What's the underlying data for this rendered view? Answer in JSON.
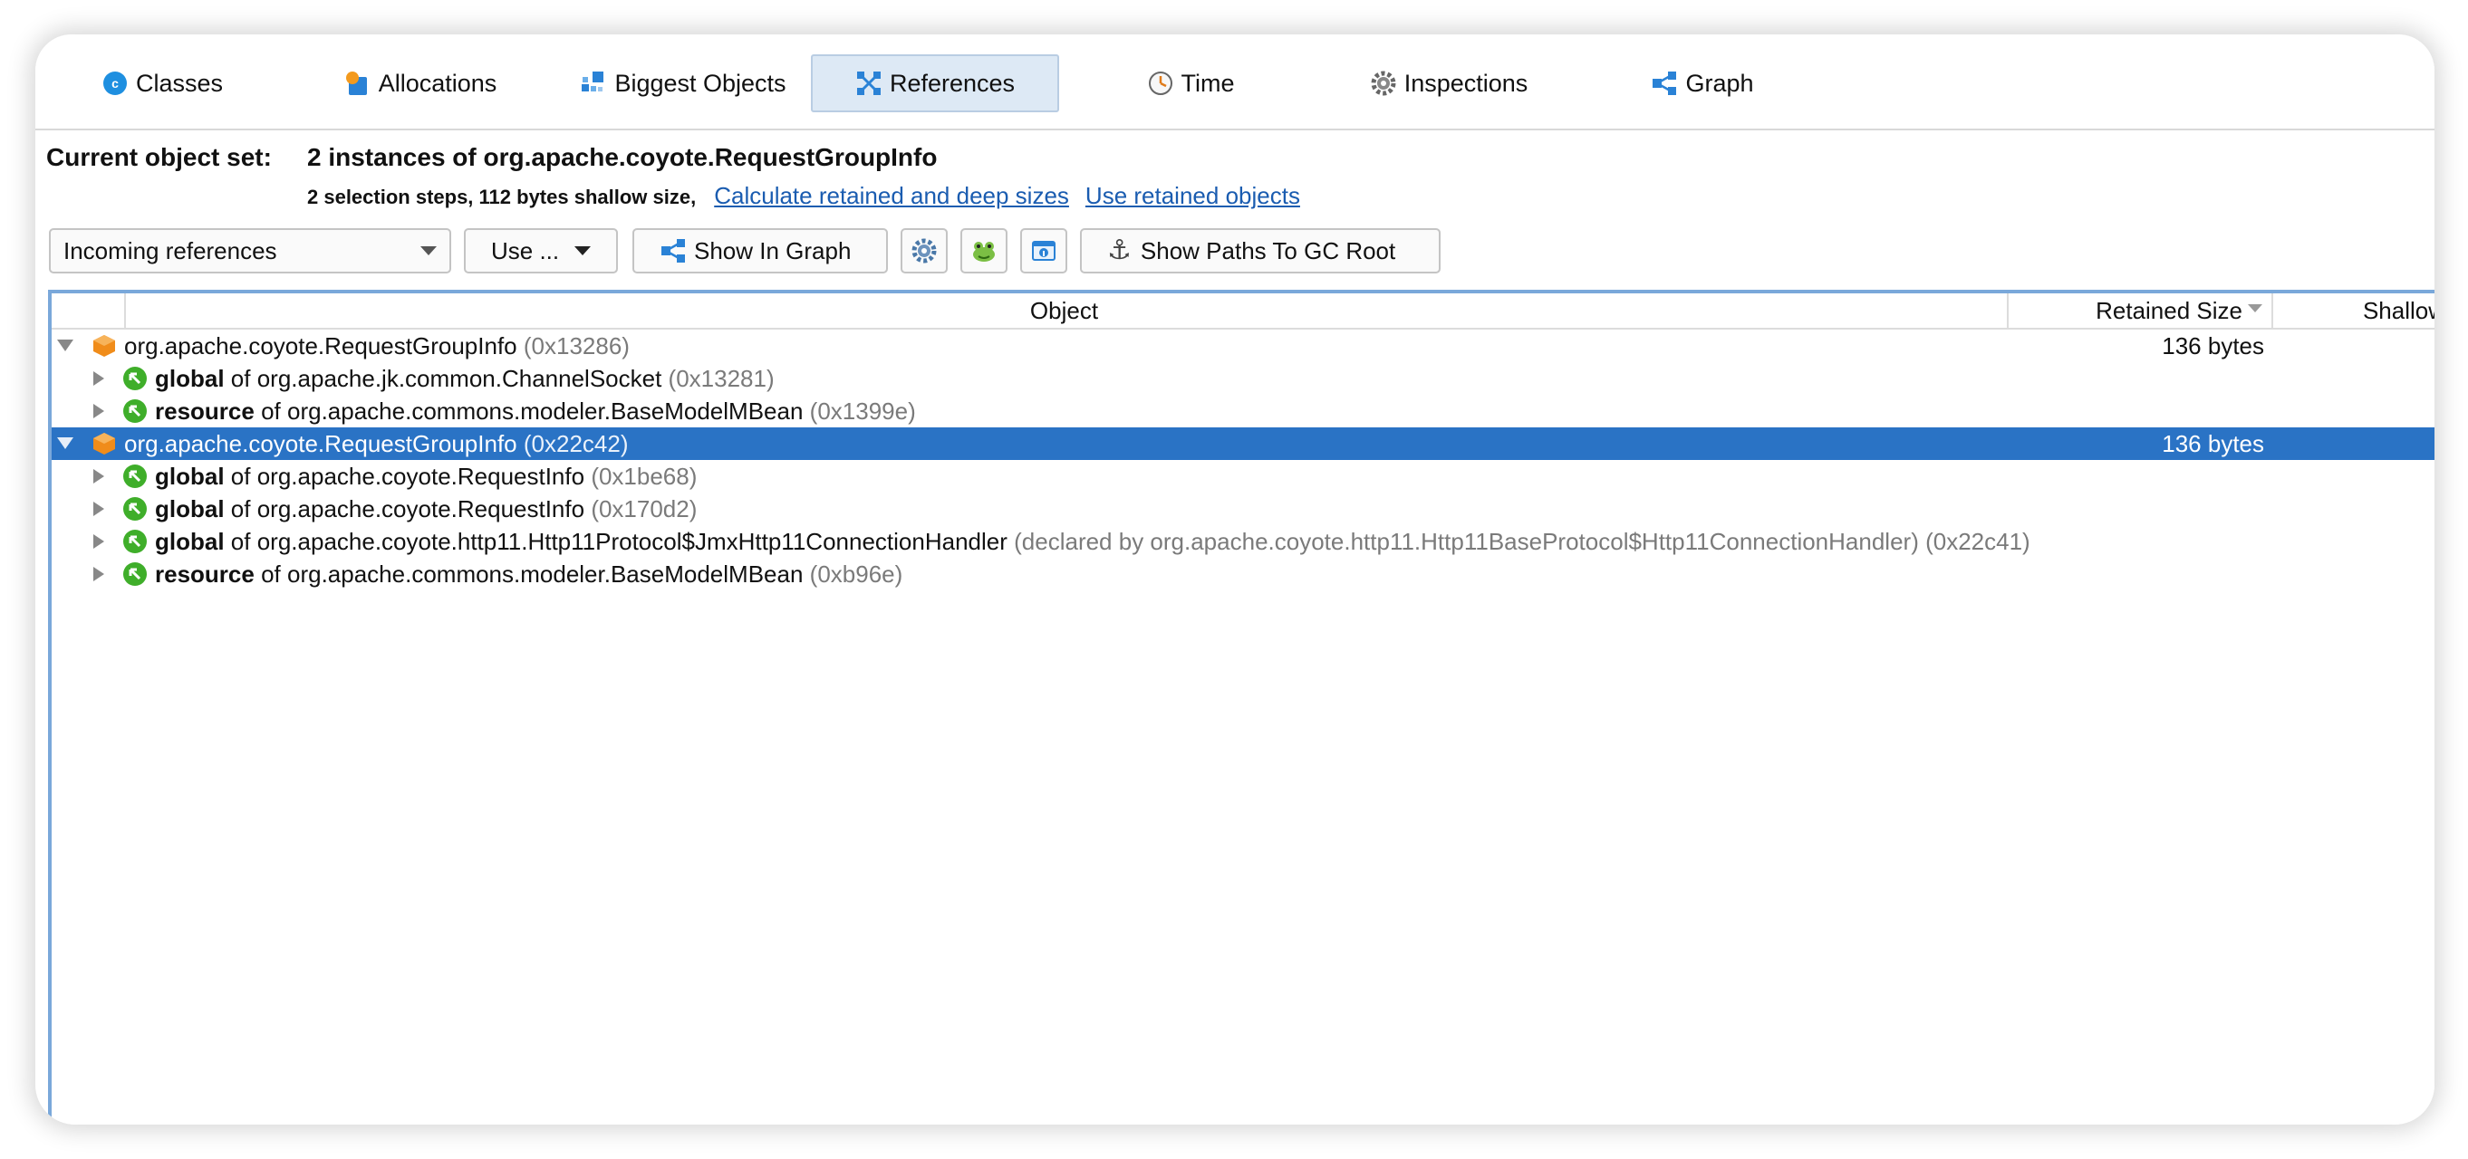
{
  "tabs": [
    {
      "label": "Classes",
      "icon": "classes-icon"
    },
    {
      "label": "Allocations",
      "icon": "allocations-icon"
    },
    {
      "label": "Biggest Objects",
      "icon": "biggest-objects-icon"
    },
    {
      "label": "References",
      "icon": "references-icon",
      "active": true
    },
    {
      "label": "Time",
      "icon": "time-icon"
    },
    {
      "label": "Inspections",
      "icon": "inspections-icon"
    },
    {
      "label": "Graph",
      "icon": "graph-icon"
    }
  ],
  "current_set": {
    "label": "Current object set:",
    "value": "2 instances of org.apache.coyote.RequestGroupInfo",
    "steps": "2 selection steps, 112 bytes shallow size,",
    "link_calculate": "Calculate retained and deep sizes",
    "link_use_retained": "Use retained objects"
  },
  "toolbar": {
    "reference_mode": "Incoming references",
    "use_menu": "Use ...",
    "show_in_graph": "Show In Graph",
    "show_paths": "Show Paths To GC Root"
  },
  "table": {
    "columns": {
      "object": "Object",
      "retained": "Retained Size",
      "shallow": "Shallow"
    },
    "rows": [
      {
        "level": 0,
        "expanded": true,
        "kind": "object",
        "name": "org.apache.coyote.RequestGroupInfo",
        "id": "(0x13286)",
        "retained": "136 bytes",
        "selected": false
      },
      {
        "level": 1,
        "expanded": false,
        "kind": "ref",
        "field": "global",
        "of": "of",
        "name": "org.apache.jk.common.ChannelSocket",
        "id": "(0x13281)"
      },
      {
        "level": 1,
        "expanded": false,
        "kind": "ref",
        "field": "resource",
        "of": "of",
        "name": "org.apache.commons.modeler.BaseModelMBean",
        "id": "(0x1399e)"
      },
      {
        "level": 0,
        "expanded": true,
        "kind": "object",
        "name": "org.apache.coyote.RequestGroupInfo",
        "id": "(0x22c42)",
        "retained": "136 bytes",
        "selected": true
      },
      {
        "level": 1,
        "expanded": false,
        "kind": "ref",
        "field": "global",
        "of": "of",
        "name": "org.apache.coyote.RequestInfo",
        "id": "(0x1be68)"
      },
      {
        "level": 1,
        "expanded": false,
        "kind": "ref",
        "field": "global",
        "of": "of",
        "name": "org.apache.coyote.RequestInfo",
        "id": "(0x170d2)"
      },
      {
        "level": 1,
        "expanded": false,
        "kind": "ref",
        "field": "global",
        "of": "of",
        "name": "org.apache.coyote.http11.Http11Protocol$JmxHttp11ConnectionHandler",
        "extra": "(declared by org.apache.coyote.http11.Http11BaseProtocol$Http11ConnectionHandler) (0x22c41)"
      },
      {
        "level": 1,
        "expanded": false,
        "kind": "ref",
        "field": "resource",
        "of": "of",
        "name": "org.apache.commons.modeler.BaseModelMBean",
        "id": "(0xb96e)"
      }
    ]
  },
  "colors": {
    "selection": "#2a73c5",
    "active_tab": "#dde9f5",
    "link": "#1a5cb0",
    "object_icon": "#f08c1a",
    "ref_icon": "#3fae2a"
  }
}
